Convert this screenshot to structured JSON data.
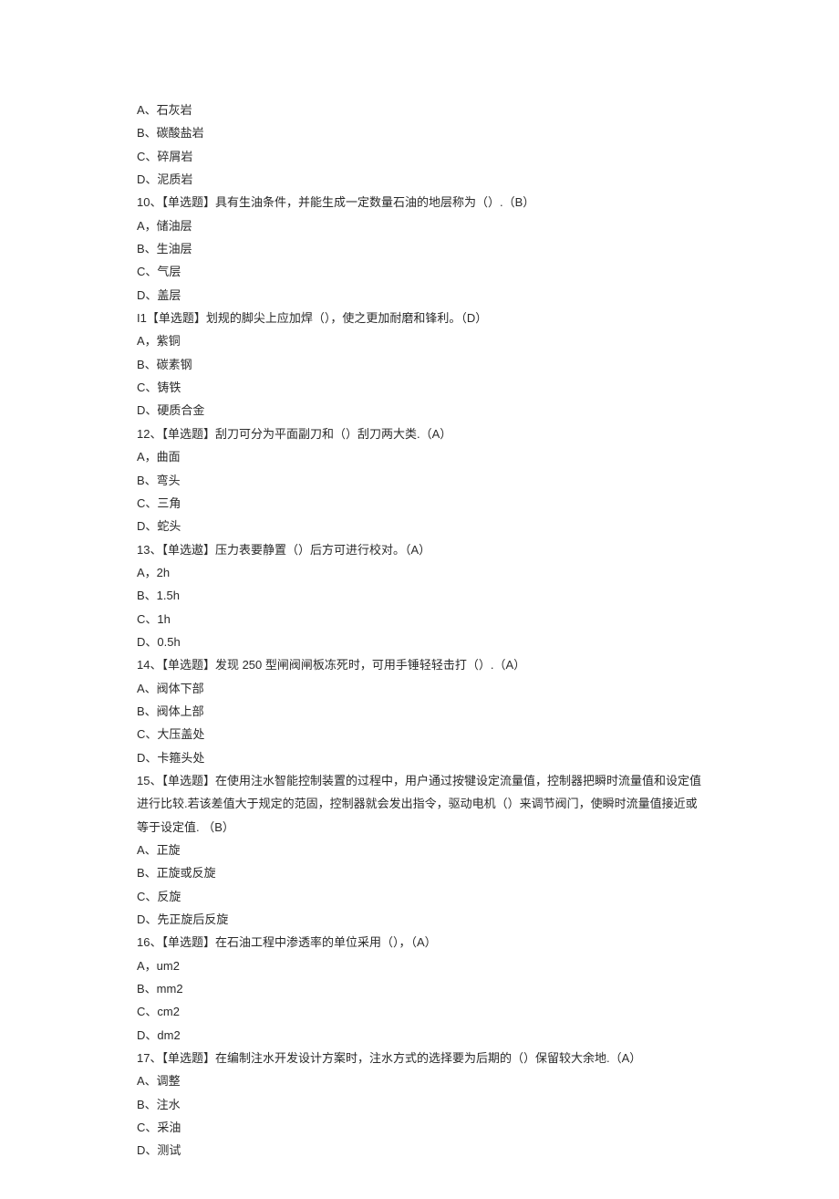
{
  "lines": [
    "A、石灰岩",
    "B、碳酸盐岩",
    "C、碎屑岩",
    "D、泥质岩",
    "10、【单选题】具有生油条件，并能生成一定数量石油的地层称为（）.（B）",
    "A，储油层",
    "B、生油层",
    "C、气层",
    "D、盖层",
    "I1【单选题】划规的脚尖上应加焊（），使之更加耐磨和锋利。（D）",
    "A，紫铜",
    "B、碳素钢",
    "C、铸铁",
    "D、硬质合金",
    "12、【单选题】刮刀可分为平面副刀和（）刮刀两大类.（A）",
    "A，曲面",
    "B、弯头",
    "C、三角",
    "D、蛇头",
    "13、【单选遨】压力表要静置（）后方可进行校对。（A）",
    "A，2h",
    "B、1.5h",
    "C、1h",
    "D、0.5h",
    "14、【单选题】发现 250 型闸阀闸板冻死时，可用手锤轻轻击打（）.（A）",
    "A、阀体下部",
    "B、阀体上部",
    "C、大压盖处",
    "D、卡箍头处",
    "15、【单选题】在使用注水智能控制装置的过程中，用户通过按犍设定流量值，控制器把瞬时流量值和设定值进行比较.若该差值大于规定的范固，控制器就会发出指令，驱动电机（）来调节阀门，使瞬时流量值接近或等于设定值. （B）",
    "A、正旋",
    "B、正旋或反旋",
    "C、反旋",
    "D、先正旋后反旋",
    "16、【单选题】在石油工程中渗透率的单位采用（），（A）",
    "A，um2",
    "B、mm2",
    "C、cm2",
    "D、dm2",
    "17、【单选题】在编制注水开发设计方案时，注水方式的选择要为后期的（）保留较大余地.（A）",
    "A、调整",
    "B、注水",
    "C、采油",
    "D、测试"
  ]
}
